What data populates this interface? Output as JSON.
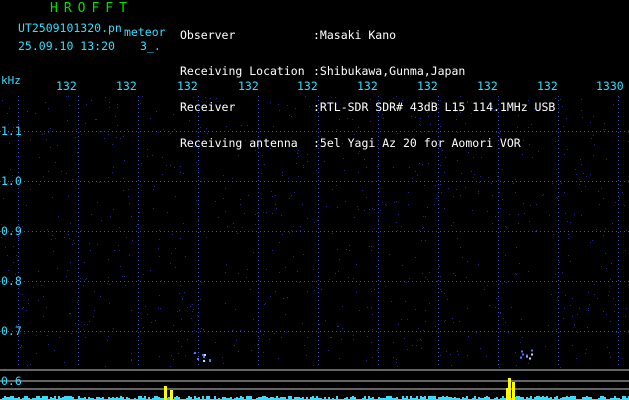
{
  "app": {
    "title": "HROFFT",
    "filename": "UT2509101320.pn",
    "tag": "meteor",
    "date": "25.09.10 13:20",
    "counter": "3_."
  },
  "header": {
    "observer_label": "Observer",
    "observer_value": ":Masaki Kano",
    "location_label": "Receiving Location",
    "location_value": ":Shibukawa,Gunma,Japan",
    "receiver_label": "Receiver",
    "receiver_value": ":RTL-SDR SDR# 43dB L15 114.1MHz USB",
    "antenna_label": "Receiving antenna",
    "antenna_value": ":5el Yagi Az 20 for Aomori VOR"
  },
  "axis": {
    "y_unit": "kHz",
    "y_ticks": [
      "1.1",
      "1.0",
      "0.9",
      "0.8",
      "0.7",
      "0.6"
    ],
    "x_ticks": [
      "132",
      "132",
      "132",
      "132",
      "132",
      "132",
      "132",
      "132",
      "132",
      "1330"
    ]
  },
  "colors": {
    "background": "#000000",
    "title": "#00e000",
    "axis_text": "#33ddff",
    "grid_dots": "#3a4fb0",
    "noise": "#1a2a90",
    "echo": "#4a7aff",
    "spectrum": "#33ddff",
    "spectrum_peak": "#ffff00",
    "baseline": "#c8c8c8"
  },
  "chart_data": {
    "type": "heatmap",
    "y_unit": "kHz",
    "yticks": [
      1.1,
      1.0,
      0.9,
      0.8,
      0.7,
      0.6
    ],
    "xticks": [
      "132",
      "132",
      "132",
      "132",
      "132",
      "132",
      "132",
      "132",
      "132",
      "1330"
    ],
    "echo_events": [
      {
        "x_tick_index": 2.3,
        "freq_khz": 0.65
      },
      {
        "x_tick_index": 7.7,
        "freq_khz": 0.655
      }
    ],
    "grid": true
  }
}
